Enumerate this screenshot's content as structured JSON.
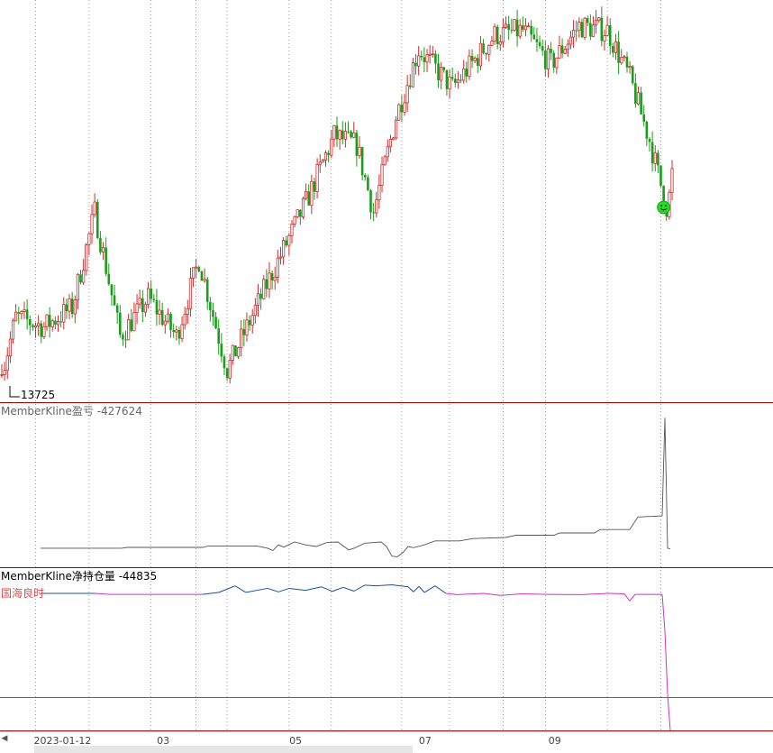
{
  "chart_data": [
    {
      "type": "candlestick",
      "panel": "price",
      "low_marker_label": "13725",
      "y_min_visible": 13725,
      "colors": {
        "up": "#d42b2b",
        "down": "#1a9e1a",
        "grid": "#888888",
        "divider": "#a80000",
        "smiley": "#22dd22"
      },
      "segments": [
        {
          "from": 0,
          "to": 5,
          "start": 13900,
          "end": 14500
        },
        {
          "from": 5,
          "to": 15,
          "start": 14500,
          "end": 14400
        },
        {
          "from": 15,
          "to": 25,
          "start": 14400,
          "end": 14600
        },
        {
          "from": 25,
          "to": 33,
          "start": 14600,
          "end": 15600
        },
        {
          "from": 33,
          "to": 42,
          "start": 15600,
          "end": 14300
        },
        {
          "from": 42,
          "to": 52,
          "start": 14300,
          "end": 14700
        },
        {
          "from": 52,
          "to": 62,
          "start": 14700,
          "end": 14300
        },
        {
          "from": 62,
          "to": 70,
          "start": 14300,
          "end": 15100
        },
        {
          "from": 70,
          "to": 80,
          "start": 15100,
          "end": 13950
        },
        {
          "from": 80,
          "to": 95,
          "start": 13950,
          "end": 14900
        },
        {
          "from": 95,
          "to": 108,
          "start": 14900,
          "end": 15700
        },
        {
          "from": 108,
          "to": 118,
          "start": 15700,
          "end": 16400
        },
        {
          "from": 118,
          "to": 126,
          "start": 16400,
          "end": 16300
        },
        {
          "from": 126,
          "to": 132,
          "start": 16300,
          "end": 15600
        },
        {
          "from": 132,
          "to": 140,
          "start": 15600,
          "end": 16600
        },
        {
          "from": 140,
          "to": 148,
          "start": 16600,
          "end": 17300
        },
        {
          "from": 148,
          "to": 160,
          "start": 17300,
          "end": 16900
        },
        {
          "from": 160,
          "to": 175,
          "start": 16900,
          "end": 17450
        },
        {
          "from": 175,
          "to": 185,
          "start": 17450,
          "end": 17500
        },
        {
          "from": 185,
          "to": 195,
          "start": 17500,
          "end": 17150
        },
        {
          "from": 195,
          "to": 205,
          "start": 17150,
          "end": 17550
        },
        {
          "from": 205,
          "to": 215,
          "start": 17550,
          "end": 17500
        },
        {
          "from": 215,
          "to": 223,
          "start": 17500,
          "end": 17000
        },
        {
          "from": 223,
          "to": 230,
          "start": 17000,
          "end": 16350
        },
        {
          "from": 230,
          "to": 236,
          "start": 16350,
          "end": 15650
        },
        {
          "from": 236,
          "to": 239,
          "start": 15650,
          "end": 16000
        }
      ],
      "candle_count": 239,
      "note_marker": "smiley at last low"
    },
    {
      "type": "line",
      "panel": "profit",
      "label": "MemberKline盈亏 -427624",
      "color": "#555555",
      "series": [
        {
          "x": 0,
          "y": 0
        },
        {
          "x": 30,
          "y": 0
        },
        {
          "x": 32,
          "y": 150
        },
        {
          "x": 60,
          "y": 150
        },
        {
          "x": 62,
          "y": 400
        },
        {
          "x": 80,
          "y": 400
        },
        {
          "x": 84,
          "y": 0
        },
        {
          "x": 86,
          "y": -400
        },
        {
          "x": 88,
          "y": 600
        },
        {
          "x": 90,
          "y": 200
        },
        {
          "x": 94,
          "y": 1100
        },
        {
          "x": 98,
          "y": 600
        },
        {
          "x": 102,
          "y": 300
        },
        {
          "x": 106,
          "y": 1000
        },
        {
          "x": 110,
          "y": 1100
        },
        {
          "x": 114,
          "y": -300
        },
        {
          "x": 116,
          "y": 0
        },
        {
          "x": 120,
          "y": 900
        },
        {
          "x": 126,
          "y": 1100
        },
        {
          "x": 128,
          "y": 300
        },
        {
          "x": 130,
          "y": -1400
        },
        {
          "x": 132,
          "y": -1500
        },
        {
          "x": 134,
          "y": -800
        },
        {
          "x": 136,
          "y": 300
        },
        {
          "x": 138,
          "y": 100
        },
        {
          "x": 142,
          "y": 600
        },
        {
          "x": 146,
          "y": 1300
        },
        {
          "x": 155,
          "y": 1300
        },
        {
          "x": 160,
          "y": 1700
        },
        {
          "x": 172,
          "y": 1900
        },
        {
          "x": 176,
          "y": 2300
        },
        {
          "x": 190,
          "y": 2300
        },
        {
          "x": 192,
          "y": 2700
        },
        {
          "x": 205,
          "y": 2700
        },
        {
          "x": 207,
          "y": 3300
        },
        {
          "x": 218,
          "y": 3300
        },
        {
          "x": 221,
          "y": 5500
        },
        {
          "x": 230,
          "y": 5700
        },
        {
          "x": 231,
          "y": 23000
        },
        {
          "x": 232,
          "y": 0
        },
        {
          "x": 233,
          "y": -100
        }
      ],
      "y_range": [
        -1600,
        23200
      ]
    },
    {
      "type": "line",
      "panel": "net_position",
      "label": "MemberKline净持仓量 -44835",
      "legend": "国海良时",
      "colors": {
        "positive": "#1a4fa0",
        "negative": "#cc33cc"
      },
      "series": [
        {
          "x": 0,
          "y": 0
        },
        {
          "x": 20,
          "y": 0
        },
        {
          "x": 26,
          "y": -40
        },
        {
          "x": 60,
          "y": -40
        },
        {
          "x": 66,
          "y": 40
        },
        {
          "x": 72,
          "y": 300
        },
        {
          "x": 76,
          "y": 40
        },
        {
          "x": 84,
          "y": 200
        },
        {
          "x": 88,
          "y": 60
        },
        {
          "x": 92,
          "y": 200
        },
        {
          "x": 98,
          "y": 120
        },
        {
          "x": 104,
          "y": 260
        },
        {
          "x": 108,
          "y": 80
        },
        {
          "x": 112,
          "y": 240
        },
        {
          "x": 116,
          "y": 90
        },
        {
          "x": 120,
          "y": 330
        },
        {
          "x": 124,
          "y": 300
        },
        {
          "x": 130,
          "y": 340
        },
        {
          "x": 136,
          "y": 260
        },
        {
          "x": 138,
          "y": 60
        },
        {
          "x": 140,
          "y": 280
        },
        {
          "x": 142,
          "y": 40
        },
        {
          "x": 146,
          "y": 300
        },
        {
          "x": 150,
          "y": 0
        },
        {
          "x": 154,
          "y": -50
        },
        {
          "x": 164,
          "y": 0
        },
        {
          "x": 170,
          "y": -80
        },
        {
          "x": 178,
          "y": -20
        },
        {
          "x": 188,
          "y": -40
        },
        {
          "x": 200,
          "y": -50
        },
        {
          "x": 210,
          "y": 0
        },
        {
          "x": 216,
          "y": -20
        },
        {
          "x": 218,
          "y": -300
        },
        {
          "x": 220,
          "y": -40
        },
        {
          "x": 230,
          "y": -40
        },
        {
          "x": 231,
          "y": -12000
        },
        {
          "x": 232,
          "y": -33000
        },
        {
          "x": 233,
          "y": -44835
        }
      ],
      "y_range": [
        -44835,
        600
      ],
      "zero_line": true
    }
  ],
  "x_axis": {
    "ticks": [
      {
        "label": "2023-01-12",
        "index": 12
      },
      {
        "label": "03",
        "index": 57
      },
      {
        "label": "05",
        "index": 104
      },
      {
        "label": "07",
        "index": 150
      },
      {
        "label": "09",
        "index": 196
      }
    ],
    "gridlines": [
      12,
      31,
      53,
      69,
      80,
      102,
      117,
      142,
      159,
      178,
      193,
      215,
      234
    ]
  },
  "ui": {
    "scroll_left_icon": "triangle-left-icon",
    "scroll_left_glyph": "◀"
  }
}
